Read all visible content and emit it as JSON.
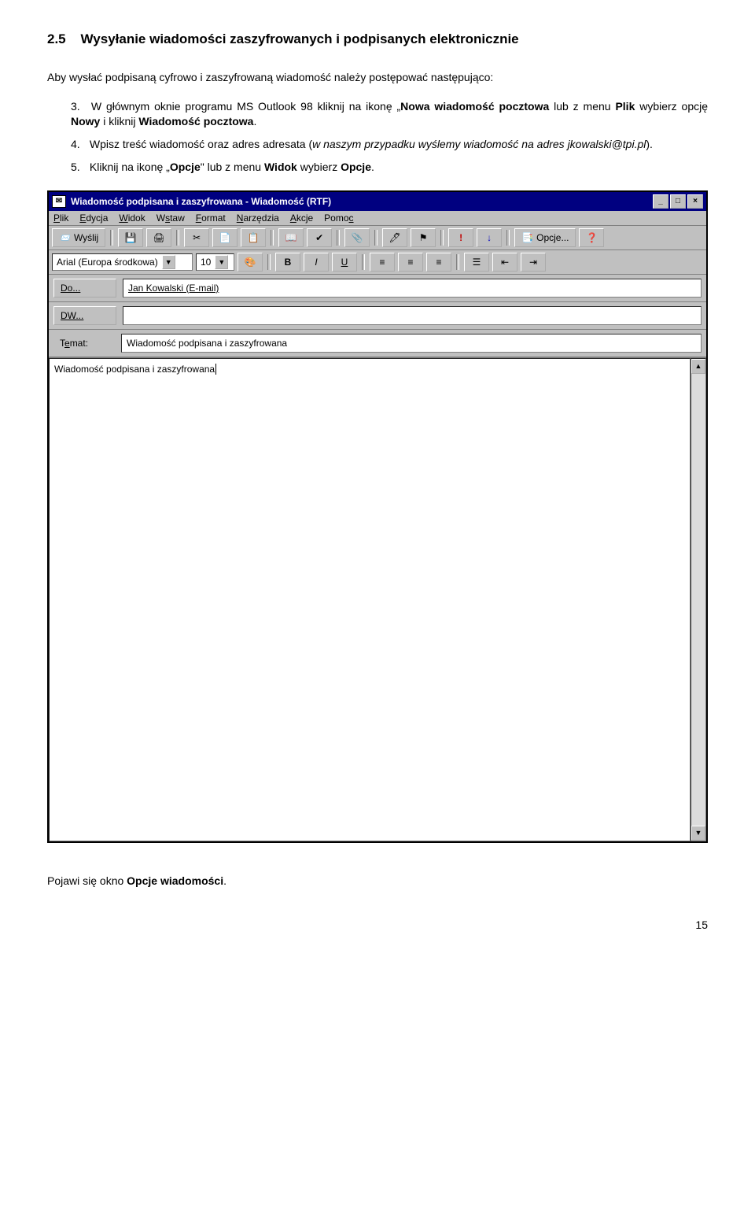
{
  "section": {
    "num": "2.5",
    "title": "Wysyłanie wiadomości zaszyfrowanych i podpisanych elektronicznie"
  },
  "intro": "Aby wysłać podpisaną cyfrowo i zaszyfrowaną wiadomość należy postępować następująco:",
  "steps": {
    "s3": {
      "n": "3.",
      "a": "W głównym oknie programu MS Outlook 98 kliknij na ikonę „",
      "b": "Nowa wiadomość pocztowa",
      "c": " lub z menu ",
      "d": "Plik",
      "e": " wybierz opcję ",
      "f": "Nowy",
      "g": " i kliknij ",
      "h": "Wiadomość pocztowa",
      "i": "."
    },
    "s4": {
      "n": "4.",
      "a": "Wpisz treść wiadomość oraz adres adresata (",
      "b": "w naszym przypadku wyślemy wiadomość na adres jkowalski@tpi.pl",
      "c": ")."
    },
    "s5": {
      "n": "5.",
      "a": "Kliknij na ikonę „",
      "b": "Opcje",
      "c": "\" lub z menu ",
      "d": "Widok",
      "e": " wybierz ",
      "f": "Opcje",
      "g": "."
    }
  },
  "win": {
    "title": "Wiadomość podpisana i zaszyfrowana - Wiadomość (RTF)",
    "menu": [
      "Plik",
      "Edycja",
      "Widok",
      "Wstaw",
      "Format",
      "Narzędzia",
      "Akcje",
      "Pomoc"
    ],
    "send": "Wyślij",
    "opcje": "Opcje...",
    "font": "Arial (Europa środkowa)",
    "fontsize": "10",
    "to_btn": "Do...",
    "to_val": "Jan Kowalski (E-mail)",
    "cc_btn": "DW...",
    "cc_val": "",
    "subj_label": "Temat:",
    "subj_val": "Wiadomość podpisana i zaszyfrowana",
    "body": "Wiadomość podpisana i zaszyfrowana"
  },
  "after": "Pojawi się okno Opcje wiadomości.",
  "after_prefix": "Pojawi się okno ",
  "after_bold": "Opcje wiadomości",
  "after_suffix": ".",
  "page": "15"
}
